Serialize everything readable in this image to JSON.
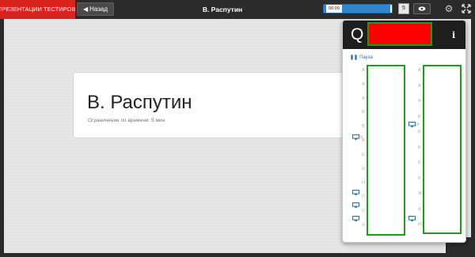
{
  "header": {
    "brand_tab": "ПРЕЗЕНТАЦИИ ТЕСТИРОВАНИЯ",
    "back_label": "Назад",
    "title": "В. Распутин",
    "timer_text": "00:00",
    "timer_progress": 0.98,
    "page_number": "5"
  },
  "slide": {
    "name": "В. Распутин",
    "time_limit": "Ограничение по времени: 5 мин."
  },
  "panel": {
    "pause_label": "Пауза",
    "left_markers": [
      "А",
      "А",
      "А",
      "В",
      "В",
      "В",
      "Е",
      "И",
      "Н",
      "П",
      "С",
      "Ч"
    ],
    "right_markers": [
      "А",
      "А",
      "А",
      "В",
      "В",
      "Б",
      "Б",
      "В",
      "Ж",
      "А",
      "Ю"
    ],
    "left_partial_label": "В",
    "right_partial_label": "В"
  },
  "colors": {
    "brand_red": "#d9241c",
    "accent_blue": "#2e86d0",
    "redaction_red": "#ff0000",
    "highlight_green": "#1a9e1a"
  },
  "icons": [
    "chevron-left-icon",
    "eye-icon",
    "gear-icon",
    "fullscreen-icon",
    "info-icon",
    "monitor-icon"
  ]
}
